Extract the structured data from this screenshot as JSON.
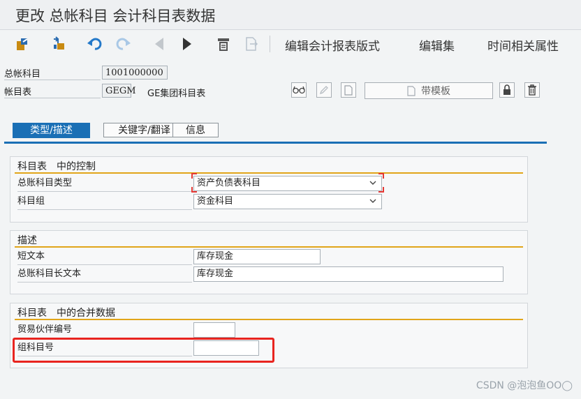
{
  "window": {
    "title": "更改 总帐科目 会计科目表数据"
  },
  "toolbar": {
    "icons": [
      "switch-icon",
      "copy-icon",
      "undo-icon",
      "redo-icon",
      "previous-icon",
      "next-icon",
      "print-icon",
      "document-icon"
    ],
    "edit_report_format": "编辑会计报表版式",
    "edit_set": "编辑集",
    "time_dependent_attributes": "时间相关属性"
  },
  "header": {
    "gl_account_label": "总帐科目",
    "gl_account_value": "1001000000",
    "coa_label": "帐目表",
    "coa_value": "GEGM",
    "coa_name": "GE集团科目表",
    "template_button": "带模板"
  },
  "tabs": [
    {
      "label": "类型/描述",
      "active": true
    },
    {
      "label": "关键字/翻译",
      "active": false
    },
    {
      "label": "信息",
      "active": false
    }
  ],
  "groups": {
    "control": {
      "title": "科目表　中的控制",
      "account_type_label": "总账科目类型",
      "account_type_value": "资产负债表科目",
      "account_group_label": "科目组",
      "account_group_value": "资金科目"
    },
    "description": {
      "title": "描述",
      "short_text_label": "短文本",
      "short_text_value": "库存现金",
      "long_text_label": "总账科目长文本",
      "long_text_value": "库存现金"
    },
    "consolidation": {
      "title": "科目表　中的合并数据",
      "trading_partner_label": "贸易伙伴编号",
      "trading_partner_value": "",
      "group_account_label": "组科目号",
      "group_account_value": ""
    }
  },
  "watermark": "CSDN @泡泡鱼OO◯",
  "colors": {
    "accent": "#1a6fb5",
    "group_bar": "#e1a519",
    "highlight": "#e8241f"
  }
}
